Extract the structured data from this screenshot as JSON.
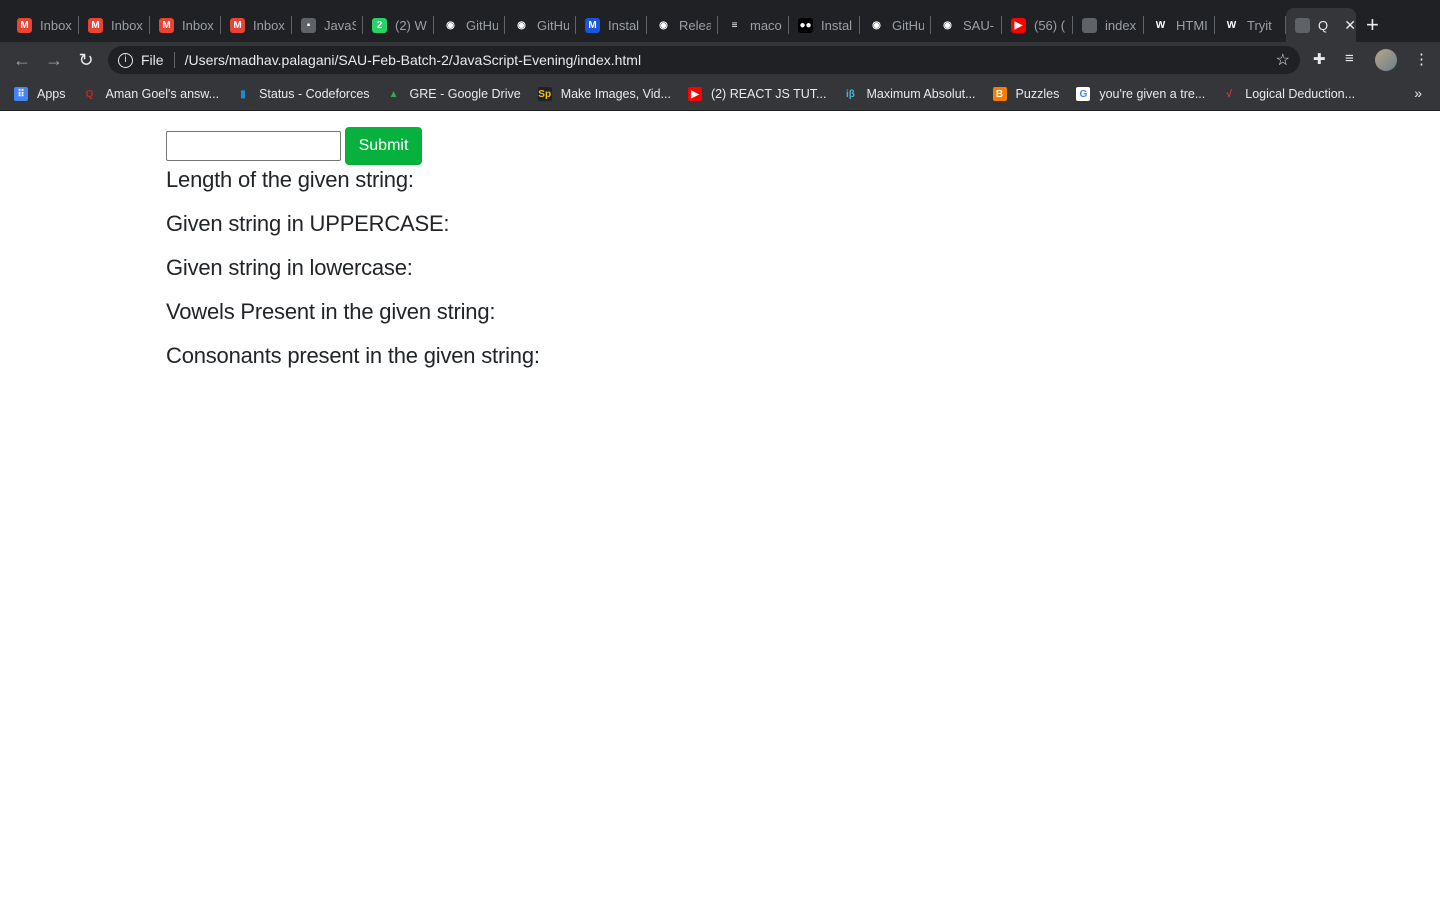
{
  "tabs": [
    {
      "label": "Inbox",
      "icon": "gmail-icon",
      "color": "#ea4335",
      "glyph": "M"
    },
    {
      "label": "Inbox",
      "icon": "gmail-icon",
      "color": "#ea4335",
      "glyph": "M"
    },
    {
      "label": "Inbox",
      "icon": "gmail-icon",
      "color": "#ea4335",
      "glyph": "M"
    },
    {
      "label": "Inbox",
      "icon": "gmail-icon",
      "color": "#ea4335",
      "glyph": "M"
    },
    {
      "label": "JavaS",
      "icon": "contact-icon",
      "color": "#5f6368",
      "glyph": "▪"
    },
    {
      "label": "(2) W",
      "icon": "whatsapp-icon",
      "color": "#25d366",
      "glyph": "2"
    },
    {
      "label": "GitHu",
      "icon": "github-icon",
      "color": "#202124",
      "glyph": "◉"
    },
    {
      "label": "GitHu",
      "icon": "github-icon",
      "color": "#202124",
      "glyph": "◉"
    },
    {
      "label": "Instal",
      "icon": "m-logo-icon",
      "color": "#1a56db",
      "glyph": "M"
    },
    {
      "label": "Relea",
      "icon": "github-icon",
      "color": "#202124",
      "glyph": "◉"
    },
    {
      "label": "maco",
      "icon": "stackoverflow-icon",
      "color": "#202124",
      "glyph": "≡"
    },
    {
      "label": "Instal",
      "icon": "medium-icon",
      "color": "#000000",
      "glyph": "●●"
    },
    {
      "label": "GitHu",
      "icon": "github-icon",
      "color": "#202124",
      "glyph": "◉"
    },
    {
      "label": "SAU-",
      "icon": "github-icon",
      "color": "#202124",
      "glyph": "◉"
    },
    {
      "label": "(56) (",
      "icon": "youtube-icon",
      "color": "#ff0000",
      "glyph": "▶"
    },
    {
      "label": "index",
      "icon": "globe-icon",
      "color": "#5f6368",
      "glyph": ""
    },
    {
      "label": "HTMI",
      "icon": "w3schools-icon",
      "color": "#202124",
      "glyph": "W"
    },
    {
      "label": "Tryit",
      "icon": "w3schools-icon",
      "color": "#202124",
      "glyph": "W"
    },
    {
      "label": "Q",
      "icon": "globe-icon",
      "color": "#5f6368",
      "glyph": "",
      "active": true
    }
  ],
  "tab_close": "✕",
  "new_tab": "+",
  "address": {
    "scheme": "File",
    "url": "/Users/madhav.palagani/SAU-Feb-Batch-2/JavaScript-Evening/index.html"
  },
  "bookmarks": [
    {
      "label": "Apps",
      "icon": "apps-icon",
      "color": "#4285f4",
      "glyph": "⠿"
    },
    {
      "label": "Aman Goel's answ...",
      "icon": "quora-icon",
      "color": "transparent",
      "glyph": "Q",
      "fg": "#b92b27"
    },
    {
      "label": "Status - Codeforces",
      "icon": "codeforces-icon",
      "color": "transparent",
      "glyph": "▮",
      "fg": "#1f8acb"
    },
    {
      "label": "GRE - Google Drive",
      "icon": "google-drive-icon",
      "color": "transparent",
      "glyph": "▲",
      "fg": "#34a853"
    },
    {
      "label": "Make Images, Vid...",
      "icon": "adobe-spark-icon",
      "color": "#202124",
      "glyph": "Sp",
      "fg": "#f5c400"
    },
    {
      "label": "(2) REACT JS TUT...",
      "icon": "youtube-icon",
      "color": "#ff0000",
      "glyph": "▶",
      "fg": "#fff"
    },
    {
      "label": "Maximum Absolut...",
      "icon": "interviewbit-icon",
      "color": "transparent",
      "glyph": "iβ",
      "fg": "#4fb3d9"
    },
    {
      "label": "Puzzles",
      "icon": "blogger-icon",
      "color": "#f57d00",
      "glyph": "B",
      "fg": "#fff"
    },
    {
      "label": "you're given a tre...",
      "icon": "google-icon",
      "color": "#fff",
      "glyph": "G",
      "fg": "#4285f4"
    },
    {
      "label": "Logical Deduction...",
      "icon": "indiabix-icon",
      "color": "transparent",
      "glyph": "√",
      "fg": "#e53935"
    }
  ],
  "page": {
    "submit_label": "Submit",
    "input_value": "",
    "results": [
      "Length of the given string:",
      "Given string in UPPERCASE:",
      "Given string in lowercase:",
      "Vowels Present in the given string:",
      "Consonants present in the given string:"
    ]
  }
}
